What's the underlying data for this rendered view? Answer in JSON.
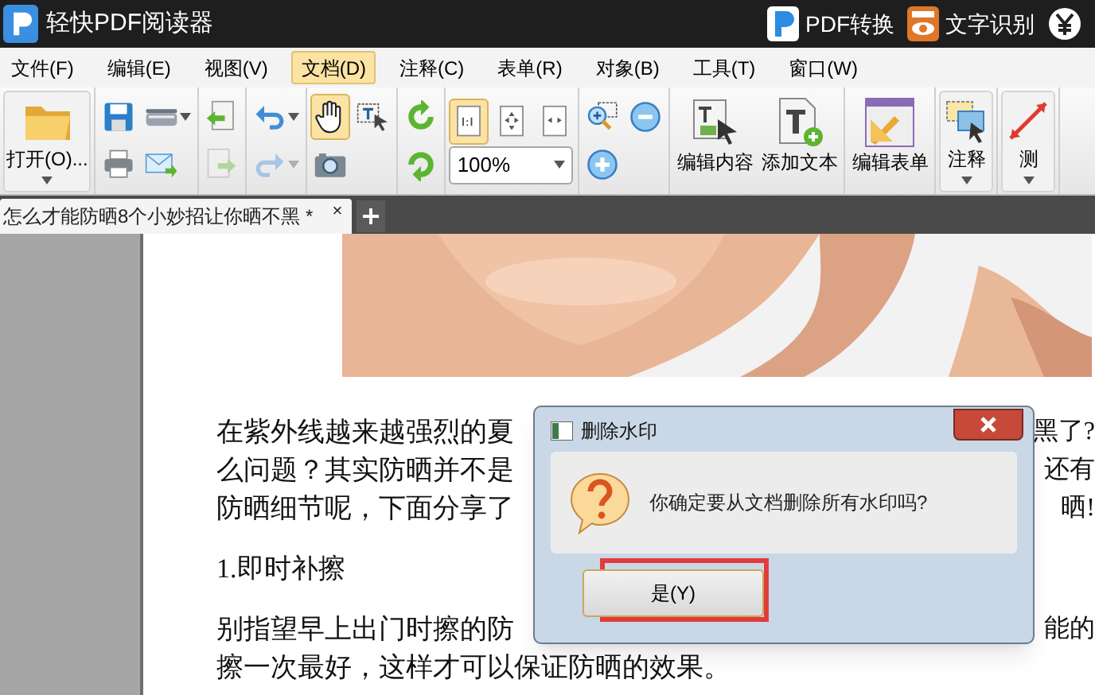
{
  "window": {
    "title": "轻快PDF阅读器"
  },
  "title_actions": [
    {
      "kind": "pdf-convert",
      "label": "PDF转换"
    },
    {
      "kind": "ocr",
      "label": "文字识别"
    },
    {
      "kind": "yen"
    }
  ],
  "menu": [
    {
      "label": "文件(F)",
      "selected": false
    },
    {
      "label": "编辑(E)",
      "selected": false
    },
    {
      "label": "视图(V)",
      "selected": false
    },
    {
      "label": "文档(D)",
      "selected": true
    },
    {
      "label": "注释(C)",
      "selected": false
    },
    {
      "label": "表单(R)",
      "selected": false
    },
    {
      "label": "对象(B)",
      "selected": false
    },
    {
      "label": "工具(T)",
      "selected": false
    },
    {
      "label": "窗口(W)",
      "selected": false
    }
  ],
  "toolbar": {
    "groups": [
      {
        "large": [
          {
            "kind": "folder",
            "label": "打开(O)...",
            "caret": true,
            "selected": false,
            "disabled": false
          }
        ]
      },
      {
        "rows": [
          [
            {
              "kind": "save",
              "caret": false,
              "selected": false,
              "disabled": false
            },
            {
              "kind": "scanner",
              "caret": true,
              "selected": false,
              "disabled": false
            }
          ],
          [
            {
              "kind": "print",
              "caret": false,
              "selected": false,
              "disabled": false
            },
            {
              "kind": "email",
              "caret": false,
              "selected": false,
              "disabled": false
            }
          ]
        ]
      },
      {
        "rows": [
          [
            {
              "kind": "page-back",
              "caret": false,
              "selected": false,
              "disabled": false
            }
          ],
          [
            {
              "kind": "page-forward",
              "caret": false,
              "selected": false,
              "disabled": true
            }
          ]
        ]
      },
      {
        "rows": [
          [
            {
              "kind": "undo",
              "caret": true,
              "selected": false,
              "disabled": false
            }
          ],
          [
            {
              "kind": "redo",
              "caret": true,
              "selected": false,
              "disabled": true
            }
          ]
        ]
      },
      {
        "rows": [
          [
            {
              "kind": "hand",
              "caret": false,
              "selected": true,
              "disabled": false
            },
            {
              "kind": "text-select",
              "caret": false,
              "selected": false,
              "disabled": false
            }
          ],
          [
            {
              "kind": "camera",
              "caret": false,
              "selected": false,
              "disabled": false
            }
          ]
        ]
      },
      {
        "rows": [
          [
            {
              "kind": "rotate-cw",
              "caret": false,
              "selected": false,
              "disabled": false
            }
          ],
          [
            {
              "kind": "rotate-ccw",
              "caret": false,
              "selected": false,
              "disabled": false
            }
          ]
        ]
      },
      {
        "rows": [
          [
            {
              "kind": "actual-size",
              "caret": false,
              "selected": true,
              "disabled": false
            },
            {
              "kind": "fit-page",
              "caret": false,
              "selected": false,
              "disabled": false
            },
            {
              "kind": "fit-width",
              "caret": false,
              "selected": false,
              "disabled": false
            }
          ],
          [
            {
              "kind": "zoom-field",
              "value": "100%"
            }
          ]
        ]
      },
      {
        "rows": [
          [
            {
              "kind": "zoom-rect",
              "caret": false,
              "selected": false,
              "disabled": false
            },
            {
              "kind": "zoom-out",
              "caret": false,
              "selected": false,
              "disabled": false
            }
          ],
          [
            {
              "kind": "zoom-in",
              "caret": false,
              "selected": false,
              "disabled": false
            }
          ]
        ]
      },
      {
        "large": [
          {
            "kind": "edit-content",
            "label": "编辑内容",
            "caret": false,
            "selected": false,
            "disabled": false
          },
          {
            "kind": "add-text",
            "label": "添加文本",
            "caret": false,
            "selected": false,
            "disabled": false
          }
        ]
      },
      {
        "large": [
          {
            "kind": "edit-form",
            "label": "编辑表单",
            "caret": false,
            "selected": false,
            "disabled": false
          }
        ]
      },
      {
        "large": [
          {
            "kind": "comment",
            "label": "注释",
            "caret": true,
            "selected": false,
            "disabled": false
          }
        ]
      },
      {
        "large": [
          {
            "kind": "measure",
            "label": "测",
            "caret": true,
            "selected": false,
            "disabled": false
          }
        ]
      }
    ]
  },
  "tabs": [
    {
      "label": "怎么才能防晒8个小妙招让你晒不黑 *",
      "close": "×",
      "selected": true
    }
  ],
  "document": {
    "paragraphs": [
      {
        "lines": [
          {
            "left": "在紫外线越来越强烈的夏",
            "right": "黑了?"
          },
          {
            "left": "么问题？其实防晒并不是",
            "right": "还有"
          },
          {
            "left": "防晒细节呢，下面分享了",
            "right": "晒!"
          }
        ]
      },
      {
        "lines": [
          {
            "left": "1.即时补擦"
          }
        ]
      },
      {
        "lines": [
          {
            "left": "别指望早上出门时擦的防",
            "right": "能的"
          },
          {
            "left": "擦一次最好，这样才可以保证防晒的效果。"
          }
        ]
      }
    ]
  },
  "dialog": {
    "title": "删除水印",
    "message": "你确定要从文档删除所有水印吗?",
    "buttons": [
      {
        "label": "是(Y)",
        "highlighted": true
      }
    ]
  }
}
